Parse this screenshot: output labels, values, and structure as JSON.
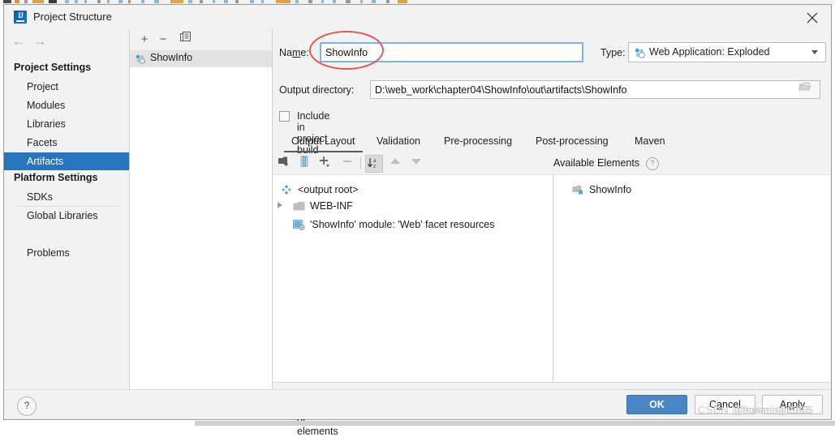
{
  "window": {
    "title": "Project Structure",
    "logo_icon": "intellij-idea-logo-icon",
    "close_icon": "close-icon"
  },
  "sidebar": {
    "back_icon": "arrow-left-icon",
    "forward_icon": "arrow-right-icon",
    "groups": [
      {
        "header": "Project Settings",
        "items": [
          "Project",
          "Modules",
          "Libraries",
          "Facets",
          "Artifacts"
        ]
      },
      {
        "header": "Platform Settings",
        "items": [
          "SDKs",
          "Global Libraries"
        ]
      }
    ],
    "problems_label": "Problems",
    "selected_item": "Artifacts",
    "selected_bg": "#2675bf"
  },
  "artifact_list": {
    "toolbar": {
      "add_label": "+",
      "remove_label": "−",
      "copy_icon": "copy-icon"
    },
    "items": [
      {
        "label": "ShowInfo",
        "icon": "artifact-icon",
        "selected": true
      }
    ]
  },
  "form": {
    "name_label": "Na",
    "name_label_mnemonic": "m",
    "name_label_rest": "e:",
    "name_value": "ShowInfo",
    "type_label": "Type:",
    "type_value": "Web Application: Exploded",
    "type_icon": "artifact-icon",
    "type_dropdown_icon": "chevron-down-icon",
    "output_dir_label": "Output directory:",
    "output_dir_value": "D:\\web_work\\chapter04\\ShowInfo\\out\\artifacts\\ShowInfo",
    "browse_icon": "folder-browse-icon",
    "include_in_build_label_pre": "Include in project ",
    "include_in_build_mnemonic": "b",
    "include_in_build_label_post": "uild",
    "include_in_build_checked": false
  },
  "tabs": [
    {
      "label": "Output Layout",
      "active": true
    },
    {
      "label": "Validation",
      "active": false
    },
    {
      "label": "Pre-processing",
      "active": false
    },
    {
      "label": "Post-processing",
      "active": false
    },
    {
      "label": "Maven",
      "active": false
    }
  ],
  "panel_toolbar": {
    "add_dir_icon": "add-directory-icon",
    "add_archive_icon": "add-archive-icon",
    "add_icon": "plus-dropdown-icon",
    "remove_icon": "minus-icon",
    "sort_icon": "sort-alphabetical-icon",
    "up_icon": "arrow-up-icon",
    "down_icon": "arrow-down-icon",
    "available_elements_title": "Available Elements",
    "help_icon": "question-mark-icon"
  },
  "output_tree": [
    {
      "label": "<output root>",
      "icon": "artifact-root-icon",
      "indent": 0,
      "expandable": false
    },
    {
      "label": "WEB-INF",
      "icon": "folder-icon",
      "indent": 1,
      "expandable": true
    },
    {
      "label": "'ShowInfo' module: 'Web' facet resources",
      "icon": "web-facet-icon",
      "indent": 1,
      "expandable": false
    }
  ],
  "available_tree": [
    {
      "label": "ShowInfo",
      "icon": "module-icon",
      "indent": 1,
      "expandable": false
    }
  ],
  "content_bottom": {
    "show_content_label": "Show content of elements",
    "show_content_checked": false,
    "dots_label": "..."
  },
  "footer": {
    "help_label": "?",
    "ok_label": "OK",
    "cancel_label_pre": "C",
    "cancel_label_mnemonic": "a",
    "cancel_label_post": "ncel",
    "apply_label_pre": "A",
    "apply_label_mnemonic": "p",
    "apply_label_post": "ply",
    "ok_color": "#4a86c5"
  },
  "annotations": {
    "ellipse_color": "#e2584d",
    "watermark": "CSDN @hosmir@2005",
    "watermark_overlay": "@hosmir@2005"
  }
}
